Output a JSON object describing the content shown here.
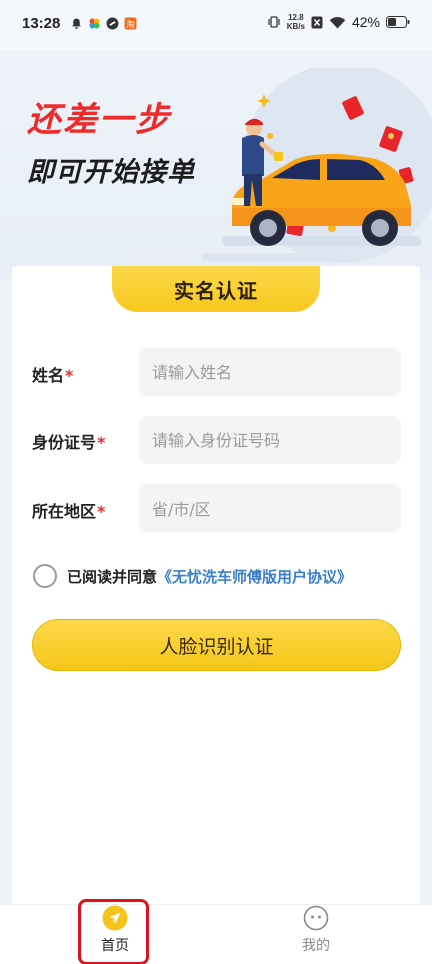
{
  "status_bar": {
    "time": "13:28",
    "net_speed_value": "12.8",
    "net_speed_unit": "KB/s",
    "battery": "42%",
    "icons": [
      "notification-bell-icon",
      "app-icon",
      "app-icon",
      "app-icon",
      "vibrate-icon",
      "sim-off-icon",
      "wifi-icon",
      "battery-icon"
    ]
  },
  "banner": {
    "title_line1": "还差一步",
    "title_line2": "即可开始接单"
  },
  "card": {
    "tab_title": "实名认证",
    "fields": [
      {
        "label": "姓名",
        "required_mark": "*",
        "placeholder": "请输入姓名"
      },
      {
        "label": "身份证号",
        "required_mark": "*",
        "placeholder": "请输入身份证号码"
      },
      {
        "label": "所在地区",
        "required_mark": "*",
        "placeholder": "省/市/区"
      }
    ],
    "agreement": {
      "text": "已阅读并同意",
      "link": "《无忧洗车师傅版用户协议》"
    },
    "submit_label": "人脸识别认证"
  },
  "tabbar": {
    "tabs": [
      {
        "label": "首页",
        "icon": "home-icon",
        "active": true
      },
      {
        "label": "我的",
        "icon": "profile-icon",
        "active": false
      }
    ]
  },
  "colors": {
    "accent_yellow": "#f7c81d",
    "required_red": "#e03232",
    "link_blue": "#3a7fc8",
    "title_red": "#ee2a2a",
    "highlight_red": "#d9141c"
  }
}
